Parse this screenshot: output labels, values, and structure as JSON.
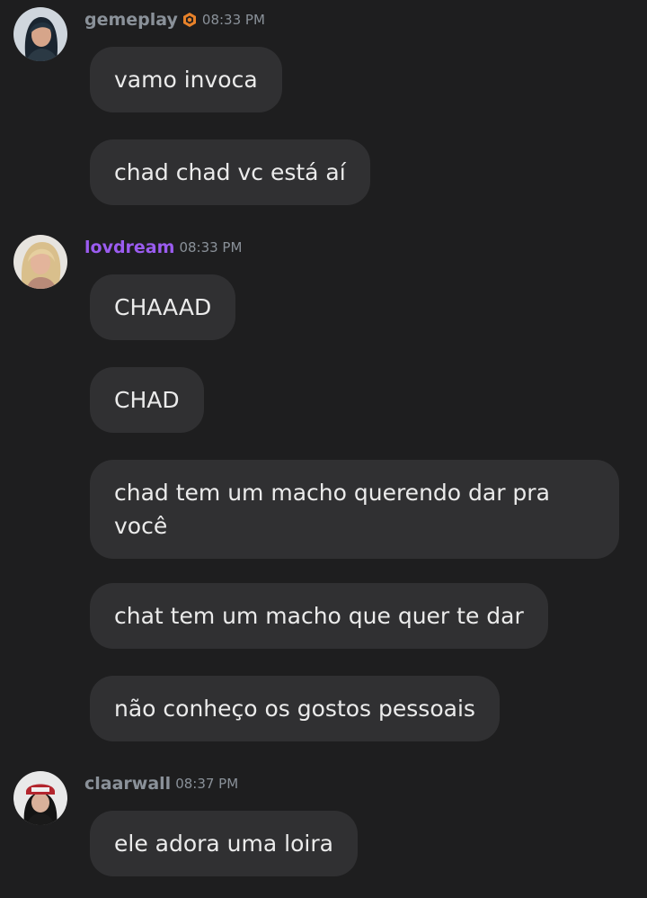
{
  "messages": [
    {
      "username": "gemeplay",
      "timestamp": "08:33 PM",
      "has_badge": true,
      "bubbles": [
        "vamo invoca",
        "chad chad vc está aí"
      ]
    },
    {
      "username": "lovdream",
      "timestamp": "08:33 PM",
      "has_badge": false,
      "bubbles": [
        "CHAAAD",
        "CHAD",
        "chad tem um macho querendo dar pra você",
        "chat tem um macho que quer te dar",
        "não conheço os gostos pessoais"
      ]
    },
    {
      "username": "claarwall",
      "timestamp": "08:37 PM",
      "has_badge": false,
      "bubbles": [
        "ele adora uma loira"
      ]
    }
  ],
  "colors": {
    "background": "#1e1e1f",
    "bubble": "#303032",
    "text": "#ebebeb",
    "username_default": "#8a9199",
    "username_lovdream": "#9b5cf0",
    "badge": "#e8822a"
  }
}
